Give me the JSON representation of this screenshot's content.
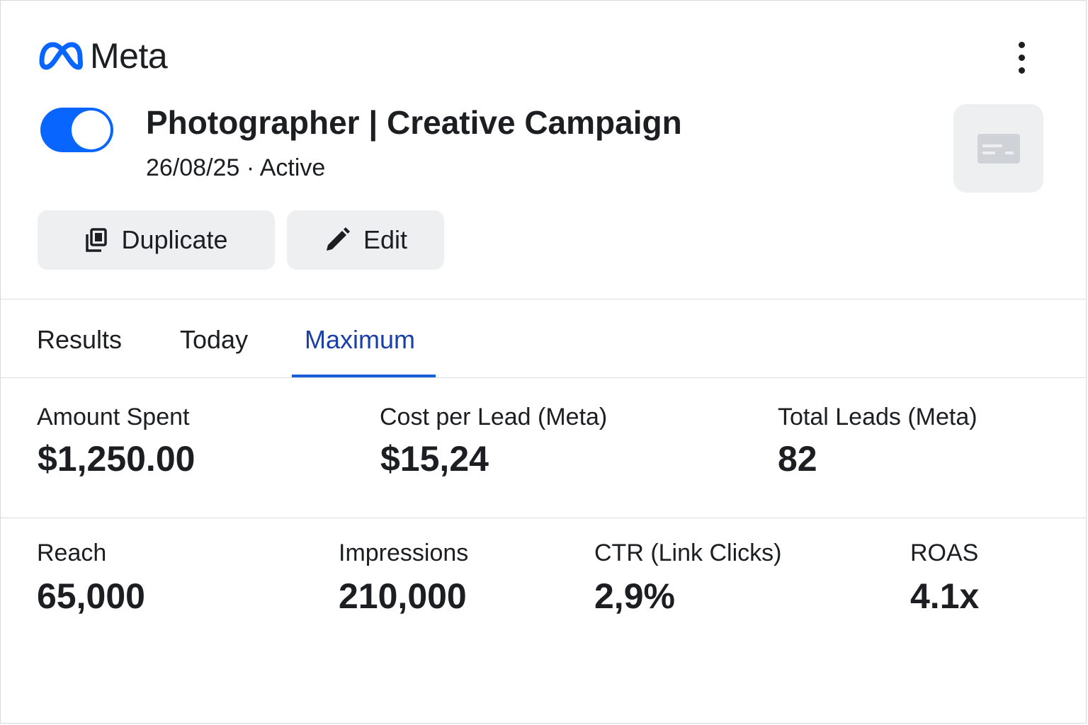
{
  "brand": {
    "name": "Meta",
    "logo_icon": "meta-infinity-icon",
    "accent_color": "#0866ff"
  },
  "header": {
    "more_icon": "more-vertical-icon"
  },
  "campaign": {
    "title": "Photographer | Creative Campaign",
    "date": "26/08/25",
    "separator": "·",
    "status": "Active",
    "enabled": true,
    "thumbnail_icon": "ad-preview-placeholder-icon"
  },
  "actions": {
    "duplicate_label": "Duplicate",
    "duplicate_icon": "duplicate-icon",
    "edit_label": "Edit",
    "edit_icon": "pencil-icon"
  },
  "tabs": [
    {
      "label": "Results",
      "active": false
    },
    {
      "label": "Today",
      "active": false
    },
    {
      "label": "Maximum",
      "active": true
    }
  ],
  "metrics_row1": [
    {
      "label": "Amount Spent",
      "value": "$1,250.00"
    },
    {
      "label": "Cost per Lead (Meta)",
      "value": "$15,24"
    },
    {
      "label": "Total Leads (Meta)",
      "value": "82"
    }
  ],
  "metrics_row2": [
    {
      "label": "Reach",
      "value": "65,000"
    },
    {
      "label": "Impressions",
      "value": "210,000"
    },
    {
      "label": "CTR (Link Clicks)",
      "value": "2,9%"
    },
    {
      "label": "ROAS",
      "value": "4.1x"
    }
  ]
}
